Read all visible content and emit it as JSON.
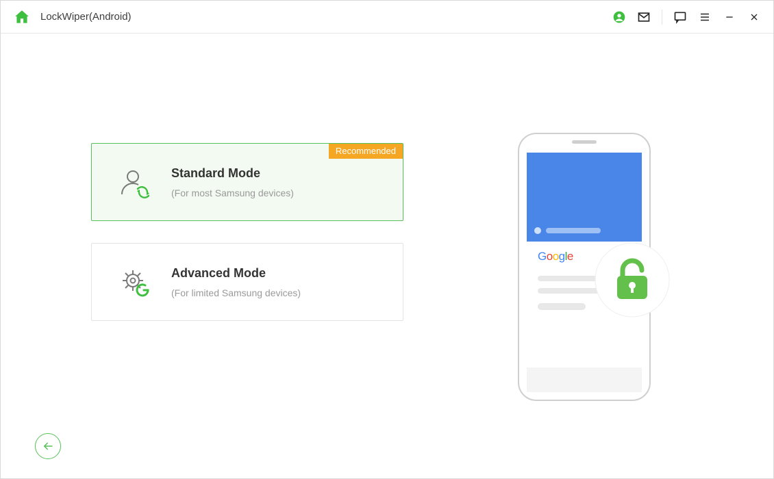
{
  "app": {
    "title": "LockWiper(Android)"
  },
  "cards": {
    "standard": {
      "badge": "Recommended",
      "title": "Standard Mode",
      "subtitle": "(For most Samsung devices)"
    },
    "advanced": {
      "title": "Advanced Mode",
      "subtitle": "(For limited Samsung devices)"
    }
  },
  "illustration": {
    "brand": "Google"
  },
  "colors": {
    "accent": "#56c158",
    "badge": "#f5a623",
    "phoneHeader": "#4a86e8"
  }
}
